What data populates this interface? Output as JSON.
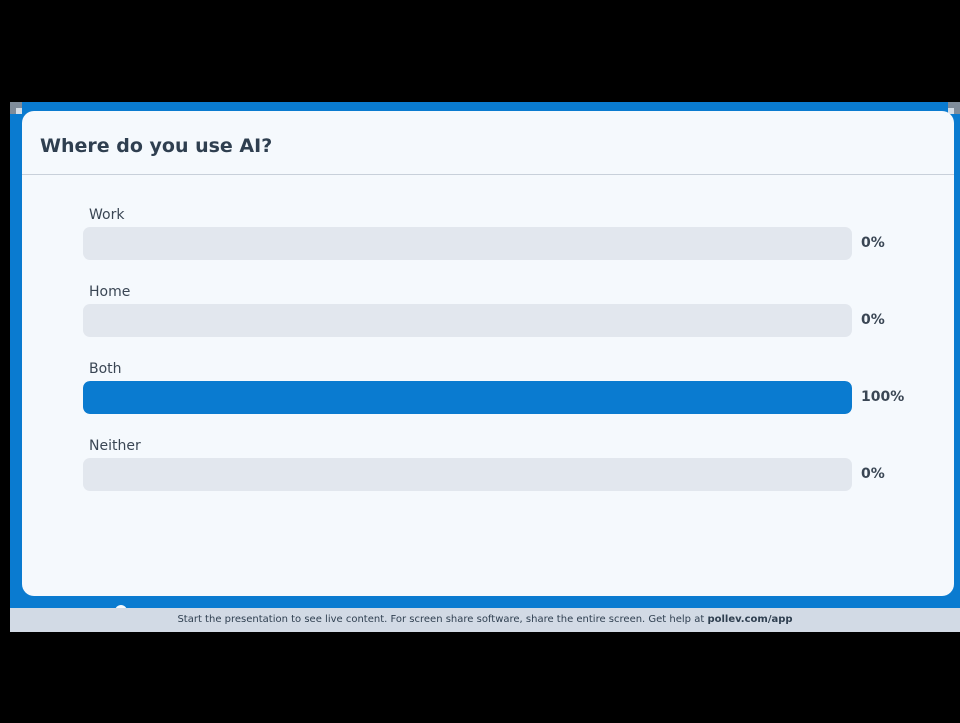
{
  "poll": {
    "question": "Where do you use AI?",
    "options": [
      {
        "label": "Work",
        "percent_label": "0%",
        "fraction": 0
      },
      {
        "label": "Home",
        "percent_label": "0%",
        "fraction": 0
      },
      {
        "label": "Both",
        "percent_label": "100%",
        "fraction": 1
      },
      {
        "label": "Neither",
        "percent_label": "0%",
        "fraction": 0
      }
    ]
  },
  "footer": {
    "message": "Start the presentation to see live content. For screen share software, share the entire screen. Get help at ",
    "link_text": "pollev.com/app"
  },
  "colors": {
    "accent": "#0a7bd0",
    "track": "#e2e7ee",
    "card_background": "#f5f9fd",
    "text": "#2f3f50"
  }
}
